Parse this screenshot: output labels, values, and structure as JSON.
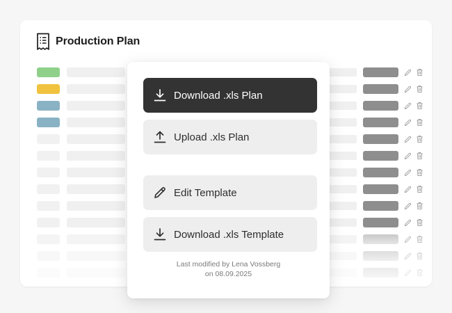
{
  "card": {
    "title": "Production Plan",
    "title_icon": "receipt-icon"
  },
  "table": {
    "row_count": 13,
    "chip_colors": [
      "#8fd08b",
      "#f0c23e",
      "#89b2c4",
      "#89b2c4"
    ],
    "status_bar_color": "#8e8e8e",
    "row_actions": [
      "pencil-icon",
      "trash-icon"
    ]
  },
  "popup": {
    "actions": [
      {
        "label": "Download .xls Plan",
        "icon": "download-icon",
        "style": "primary"
      },
      {
        "label": "Upload .xls Plan",
        "icon": "upload-icon",
        "style": "secondary"
      },
      {
        "label": "Edit Template",
        "icon": "pencil-icon",
        "style": "secondary"
      },
      {
        "label": "Download .xls Template",
        "icon": "download-icon",
        "style": "secondary"
      }
    ],
    "last_modified_line1": "Last modified by Lena Vossberg",
    "last_modified_line2": "on 08.09.2025"
  }
}
